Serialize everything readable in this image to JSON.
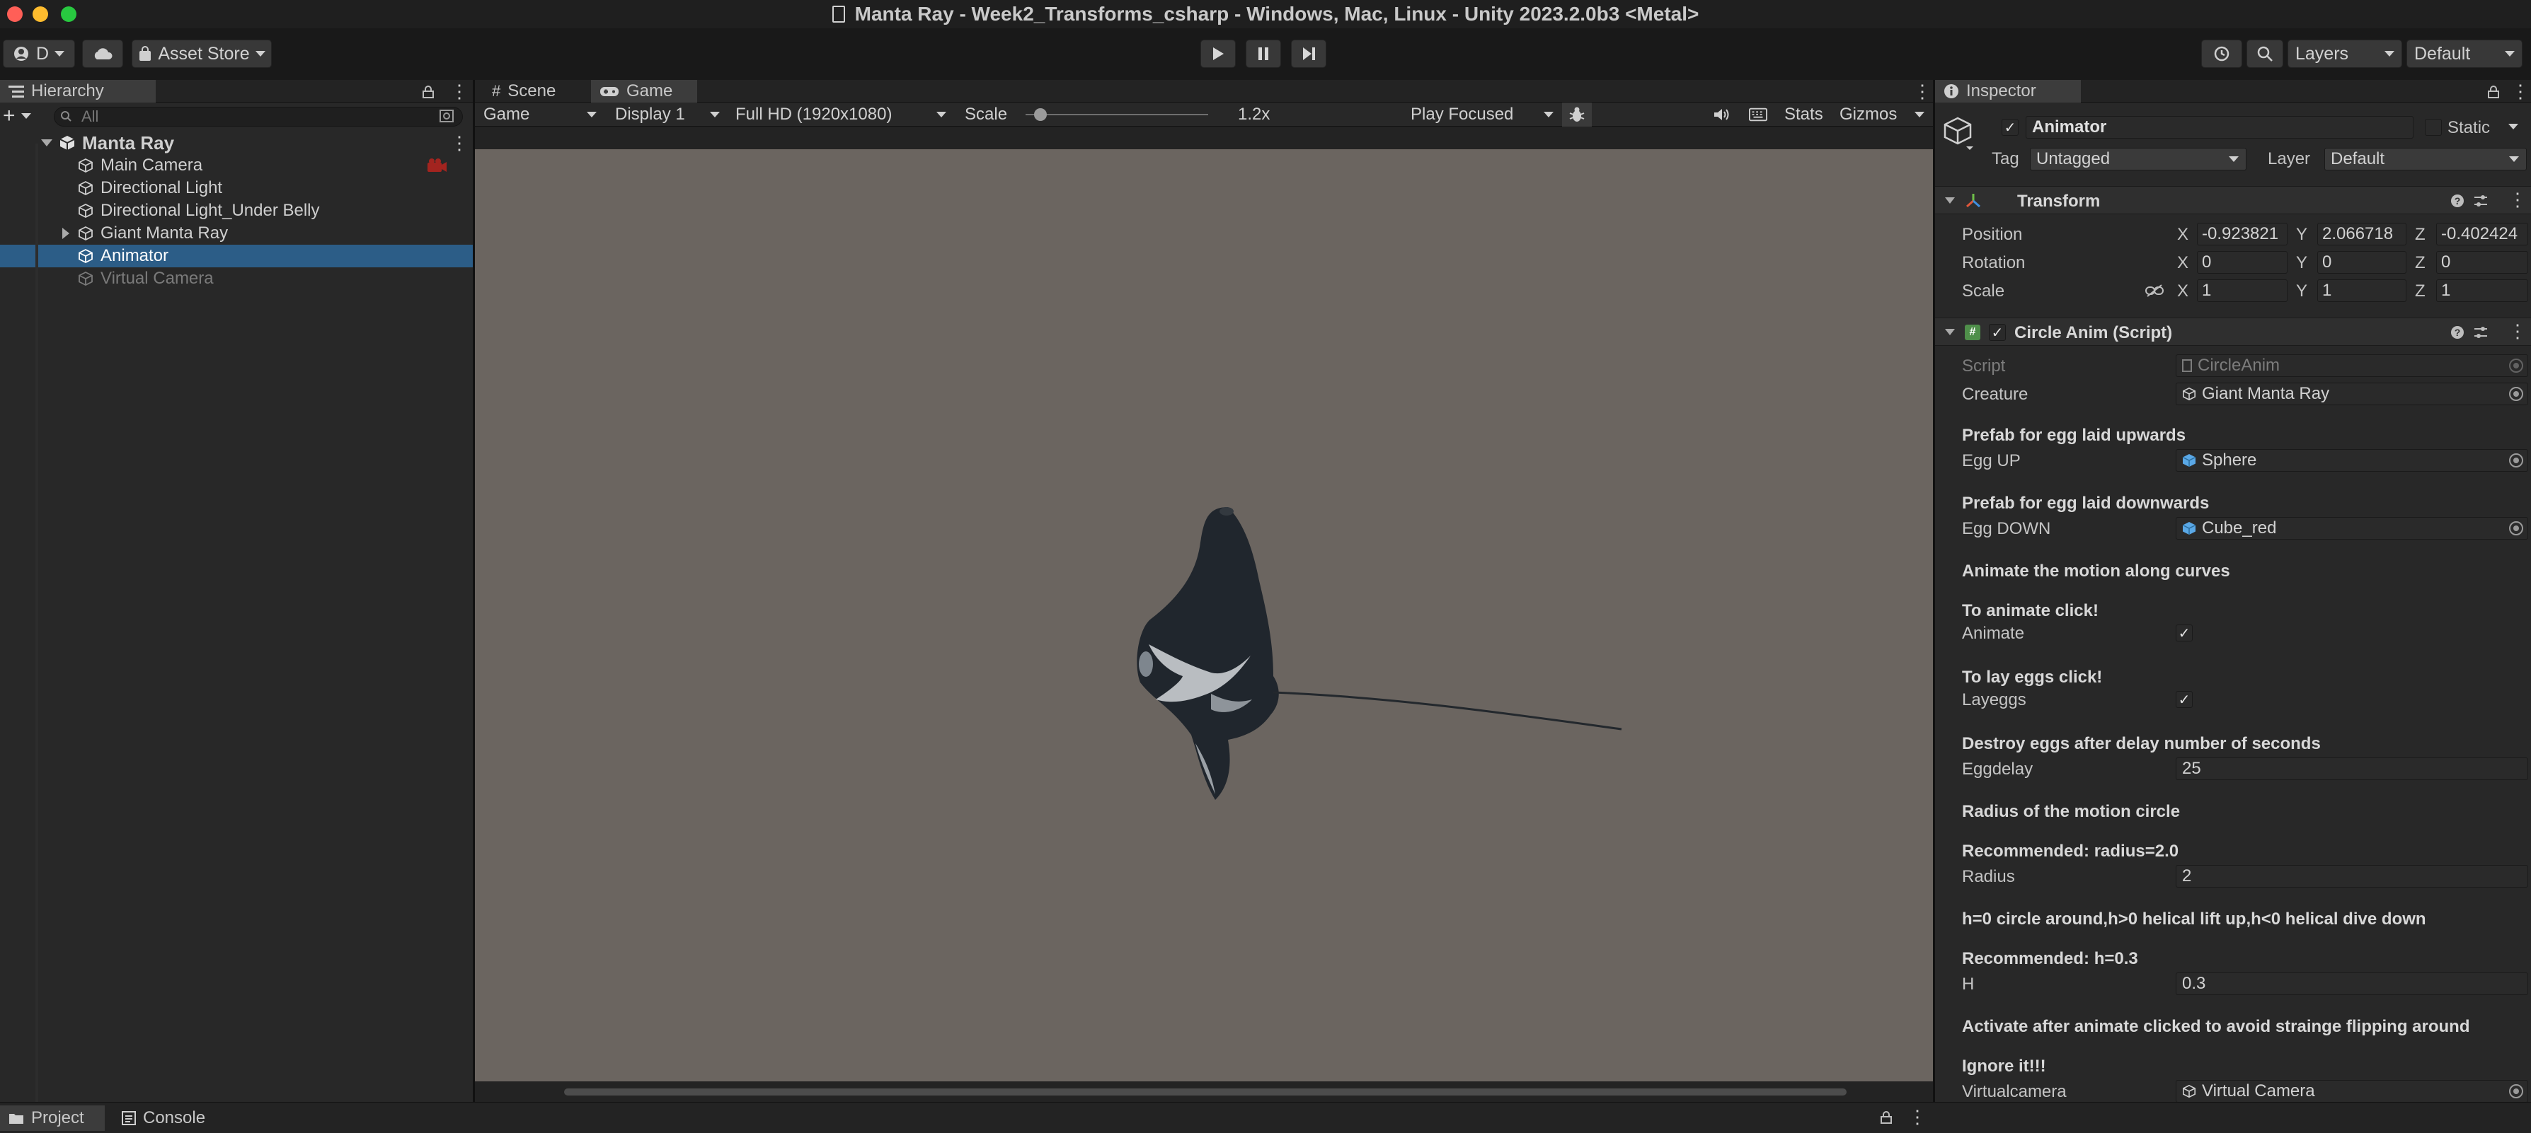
{
  "window": {
    "title": "Manta Ray - Week2_Transforms_csharp - Windows, Mac, Linux - Unity 2023.2.0b3 <Metal>",
    "colors": {
      "close": "#ff5f57",
      "minimize": "#febc2e",
      "zoom": "#28c840"
    }
  },
  "toolbar": {
    "account_label": "D",
    "asset_store_label": "Asset Store",
    "layers_label": "Layers",
    "layout_label": "Default"
  },
  "hierarchy": {
    "tab_label": "Hierarchy",
    "search_placeholder": "All",
    "scene_name": "Manta Ray",
    "items": [
      {
        "label": "Main Camera"
      },
      {
        "label": "Directional Light"
      },
      {
        "label": "Directional Light_Under Belly"
      },
      {
        "label": "Giant Manta Ray"
      },
      {
        "label": "Animator"
      },
      {
        "label": "Virtual Camera"
      }
    ]
  },
  "game_view": {
    "tabs": [
      {
        "label": "Scene"
      },
      {
        "label": "Game"
      }
    ],
    "mode": "Game",
    "display": "Display 1",
    "resolution": "Full HD (1920x1080)",
    "scale_label": "Scale",
    "scale_value": "1.2x",
    "play_mode": "Play Focused",
    "stats_label": "Stats",
    "gizmos_label": "Gizmos",
    "background_color": "#6b6560"
  },
  "inspector": {
    "tab_label": "Inspector",
    "object_name": "Animator",
    "static_label": "Static",
    "tag_label": "Tag",
    "tag_value": "Untagged",
    "layer_label": "Layer",
    "layer_value": "Default",
    "transform": {
      "title": "Transform",
      "position": {
        "label": "Position",
        "x": "-0.923821",
        "y": "2.066718",
        "z": "-0.402424"
      },
      "rotation": {
        "label": "Rotation",
        "x": "0",
        "y": "0",
        "z": "0"
      },
      "scale": {
        "label": "Scale",
        "x": "1",
        "y": "1",
        "z": "1"
      }
    },
    "script": {
      "title": "Circle Anim (Script)",
      "script_label": "Script",
      "script_value": "CircleAnim",
      "creature_label": "Creature",
      "creature_value": "Giant Manta Ray",
      "egg_up_header": "Prefab for egg laid upwards",
      "egg_up_label": "Egg UP",
      "egg_up_value": "Sphere",
      "egg_down_header": "Prefab for egg laid downwards",
      "egg_down_label": "Egg DOWN",
      "egg_down_value": "Cube_red",
      "animate_section": "Animate the motion along curves",
      "animate_header": "To animate click!",
      "animate_label": "Animate",
      "layeggs_header": "To lay eggs click!",
      "layeggs_label": "Layeggs",
      "eggdelay_header": "Destroy eggs after delay number of seconds",
      "eggdelay_label": "Eggdelay",
      "eggdelay_value": "25",
      "radius_section": "Radius of the motion circle",
      "radius_header": "Recommended: radius=2.0",
      "radius_label": "Radius",
      "radius_value": "2",
      "h_section": "h=0 circle around,h>0 helical lift up,h<0 helical dive down",
      "h_header": "Recommended: h=0.3",
      "h_label": "H",
      "h_value": "0.3",
      "vcam_section": "Activate after animate clicked to avoid strainge flipping around",
      "vcam_header": "Ignore it!!!",
      "vcam_label": "Virtualcamera",
      "vcam_value": "Virtual Camera"
    }
  },
  "bottom": {
    "project_label": "Project",
    "console_label": "Console"
  }
}
